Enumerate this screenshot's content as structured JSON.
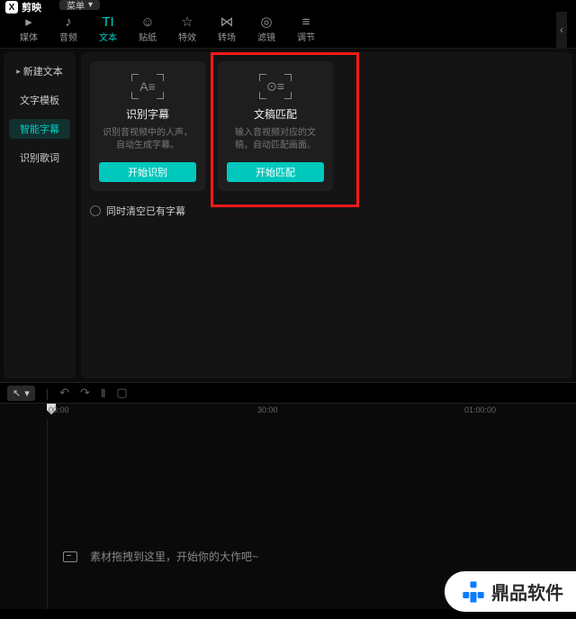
{
  "title_bar": {
    "app_name": "剪映",
    "menu_label": "菜单"
  },
  "main_tabs": [
    {
      "icon": "▸",
      "label": "媒体"
    },
    {
      "icon": "♪",
      "label": "音频"
    },
    {
      "icon": "TI",
      "label": "文本"
    },
    {
      "icon": "☺",
      "label": "贴纸"
    },
    {
      "icon": "☆",
      "label": "特效"
    },
    {
      "icon": "⋈",
      "label": "转场"
    },
    {
      "icon": "◎",
      "label": "滤镜"
    },
    {
      "icon": "≡",
      "label": "调节"
    }
  ],
  "sidebar": {
    "items": [
      {
        "label": "新建文本"
      },
      {
        "label": "文字模板"
      },
      {
        "label": "智能字幕"
      },
      {
        "label": "识别歌词"
      }
    ]
  },
  "cards": [
    {
      "glyph": "A≡",
      "title": "识别字幕",
      "desc": "识别音视频中的人声，自动生成字幕。",
      "button": "开始识别"
    },
    {
      "glyph": "⊙≡",
      "title": "文稿匹配",
      "desc": "输入音视频对应的文稿，自动匹配画面。",
      "button": "开始匹配"
    }
  ],
  "clear_label": "同时清空已有字幕",
  "ruler": {
    "ticks": [
      "00:00",
      "30:00",
      "01:00:00"
    ]
  },
  "drop_hint": "素材拖拽到这里，开始你的大作吧~",
  "watermark": "鼎品软件"
}
